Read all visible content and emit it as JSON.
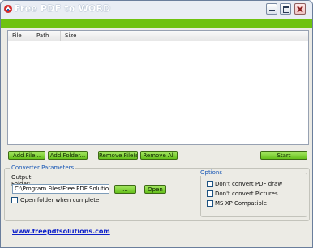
{
  "window": {
    "title": "Free PDF to WORD"
  },
  "file_list": {
    "columns": [
      "File",
      "Path",
      "Size"
    ],
    "rows": []
  },
  "toolbar": {
    "add_file": "Add File...",
    "add_folder": "Add Folder...",
    "remove_files": "Remove File(s)",
    "remove_all": "Remove All",
    "start": "Start"
  },
  "converter": {
    "group_title": "Converter Parameters",
    "output_label_line1": "Output",
    "output_label_line2": "Folder:",
    "output_folder_value": "C:\\Program Files\\Free PDF Solutions",
    "browse_label": "...",
    "open_label": "Open",
    "open_when_complete": "Open folder when complete"
  },
  "options": {
    "group_title": "Options",
    "dont_convert_draw": "Don't convert PDF draw",
    "dont_convert_pictures": "Don't convert Pictures",
    "ms_xp_compatible": "MS XP Compatible"
  },
  "footer": {
    "link": "www.freepdfsolutions.com"
  },
  "colors": {
    "menubar": "#6fc20f",
    "button_green": "#66c11c",
    "link": "#0f21c9",
    "group_title": "#1a58b5"
  }
}
